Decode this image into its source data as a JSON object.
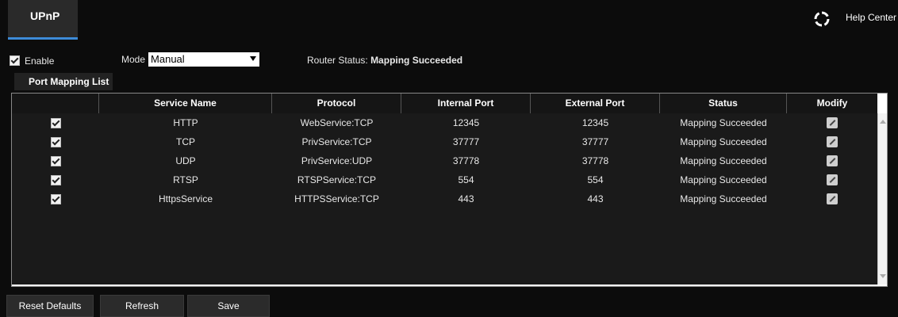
{
  "header": {
    "tab_label": "UPnP",
    "help_label": "Help Center"
  },
  "controls": {
    "enable_label": "Enable",
    "enable_checked": true,
    "mode_label": "Mode",
    "mode_value": "Manual",
    "router_status_label": "Router Status:",
    "router_status_value": "Mapping Succeeded"
  },
  "list_tab_label": "Port Mapping List",
  "table": {
    "columns": [
      "",
      "Service Name",
      "Protocol",
      "Internal Port",
      "External Port",
      "Status",
      "Modify"
    ],
    "rows": [
      {
        "checked": true,
        "service": "HTTP",
        "protocol": "WebService:TCP",
        "internal": "12345",
        "external": "12345",
        "status": "Mapping Succeeded"
      },
      {
        "checked": true,
        "service": "TCP",
        "protocol": "PrivService:TCP",
        "internal": "37777",
        "external": "37777",
        "status": "Mapping Succeeded"
      },
      {
        "checked": true,
        "service": "UDP",
        "protocol": "PrivService:UDP",
        "internal": "37778",
        "external": "37778",
        "status": "Mapping Succeeded"
      },
      {
        "checked": true,
        "service": "RTSP",
        "protocol": "RTSPService:TCP",
        "internal": "554",
        "external": "554",
        "status": "Mapping Succeeded"
      },
      {
        "checked": true,
        "service": "HttpsService",
        "protocol": "HTTPSService:TCP",
        "internal": "443",
        "external": "443",
        "status": "Mapping Succeeded"
      }
    ]
  },
  "buttons": {
    "reset": "Reset Defaults",
    "refresh": "Refresh",
    "save": "Save"
  },
  "colors": {
    "accent": "#3d8bd8",
    "background": "#0c0c0c",
    "table_body": "#ffffff"
  }
}
